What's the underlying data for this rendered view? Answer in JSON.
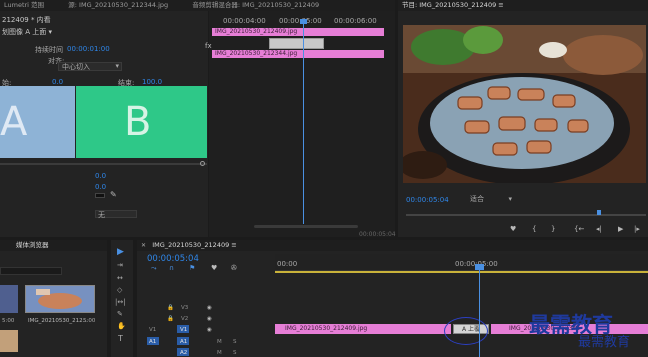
{
  "panels": {
    "effect_controls": {
      "tabs": [
        "Lumetri 范围",
        "源: IMG_20210530_212344.jpg",
        "音频剪辑混合器: IMG_20210530_212409"
      ],
      "clip_crumb": "212409 * 内看",
      "effect_label": "划图像 A 上面 ▾",
      "duration_label": "持续时间",
      "duration_value": "00:00:01:00",
      "align_label": "对齐:",
      "align_value": "中心切入",
      "start_label": "始:",
      "start_value": "0.0",
      "end_label": "结束:",
      "end_value": "100.0",
      "preview_a": "A",
      "preview_b": "B",
      "param_value_1": "0.0",
      "param_value_2": "0.0",
      "dropdown_value": "无"
    },
    "mini_timeline": {
      "ruler": [
        "00:00:04:00",
        "00:00:05:00",
        "00:00:06:00"
      ],
      "clip_label": "IMG_20210530_212409.jpg",
      "clip_label_2": "IMG_20210530_212344.jpg",
      "fx": "fx",
      "footer_time": "00:00:05:04"
    },
    "program_monitor": {
      "title": "节目: IMG_20210530_212409 ≡",
      "timecode": "00:00:05:04",
      "fit": "适合"
    },
    "media_browser": {
      "tab": "媒体浏览器",
      "item1_name": "IMG_20210530_212...",
      "item1_dur": "5:00",
      "item2_dur": "5:00"
    },
    "sequence": {
      "tab_label": "IMG_20210530_212409 ≡",
      "timecode": "00:00:05:04",
      "ruler": [
        "00:00",
        "00:00:05:00"
      ],
      "tracks": [
        "V3",
        "V2",
        "V1",
        "A1",
        "A2"
      ],
      "src_v1": "V1",
      "src_a1": "A1",
      "track_m": "M",
      "track_s": "S",
      "clip_v1_left": "IMG_20210530_212409.jpg",
      "clip_v1_right": "IMG_20210530_212344",
      "transition": "A 上覆"
    },
    "watermark": {
      "title": "最需教育",
      "subtitle": "最需教育"
    }
  },
  "colors": {
    "accent": "#2f86e8",
    "clip_pink": "#e67ed6",
    "preview_blue": "#8eb3d6",
    "preview_green": "#2ec888",
    "playhead": "#4a90e2",
    "watermark": "#1f3a9e"
  }
}
